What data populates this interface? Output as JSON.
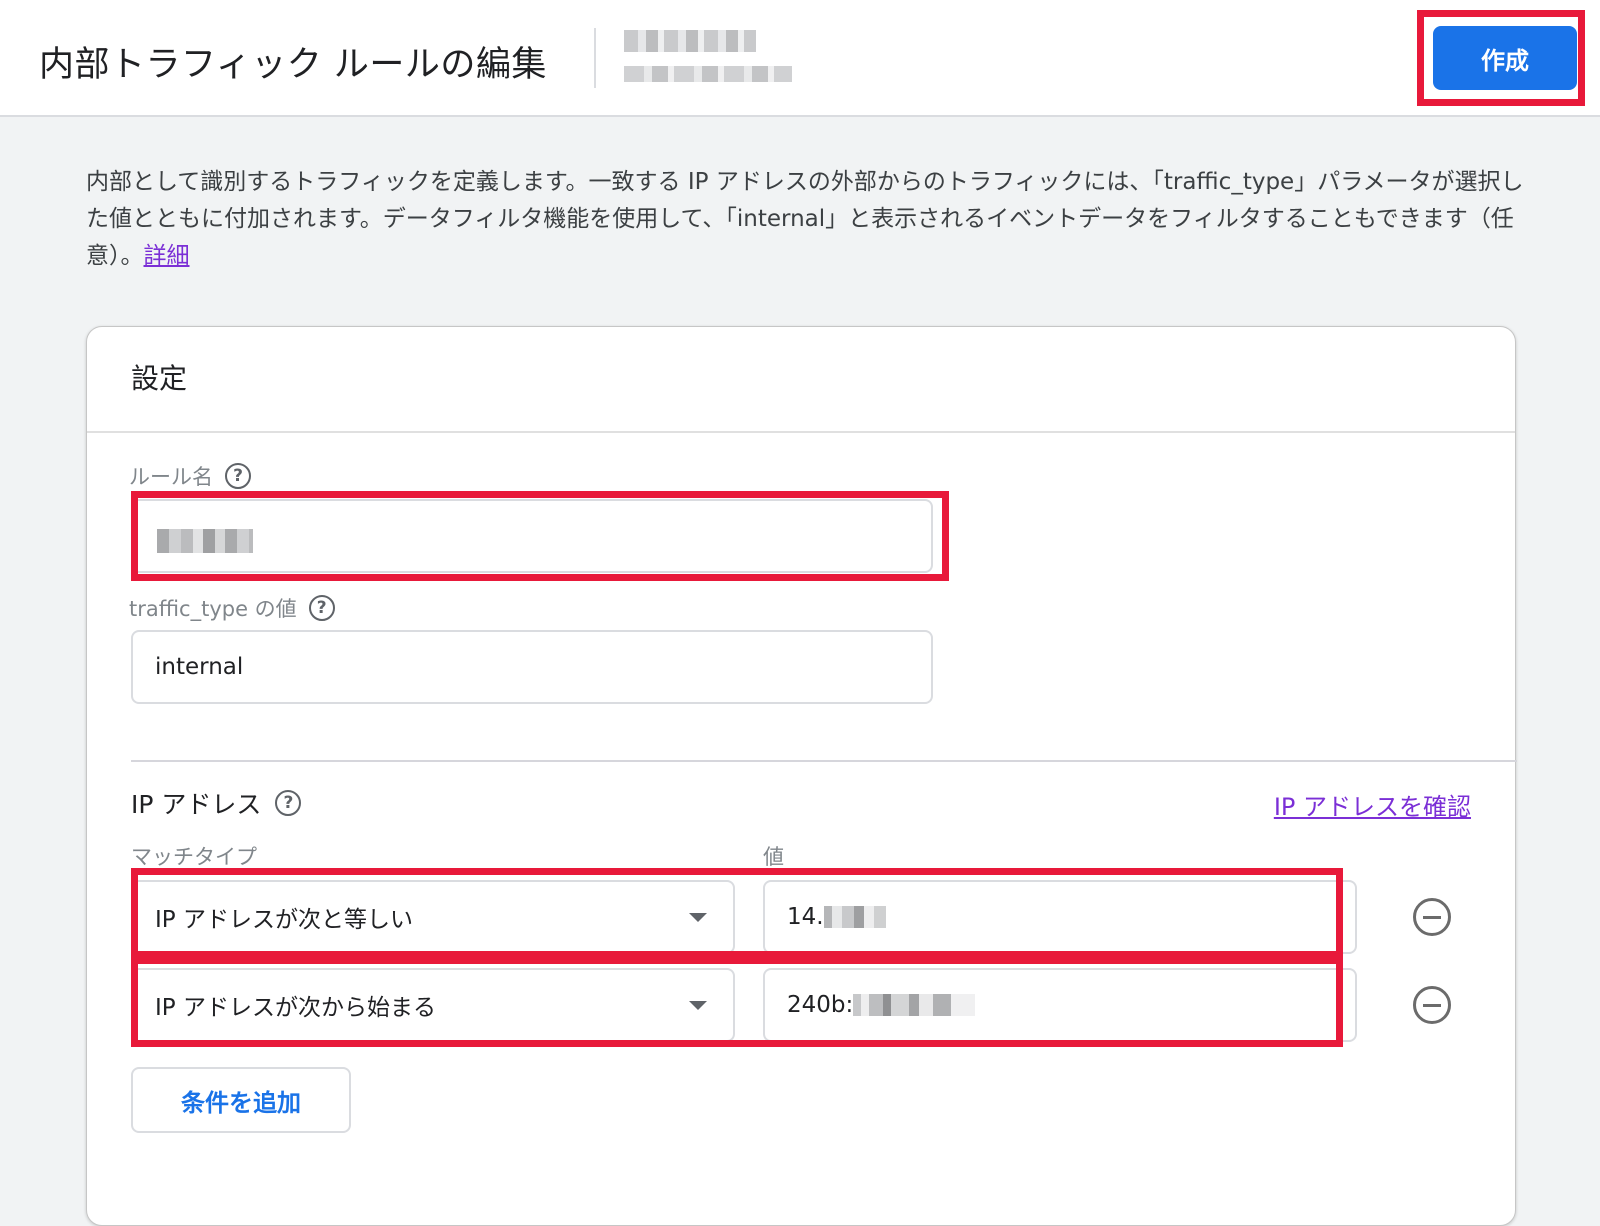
{
  "header": {
    "title": "内部トラフィック ルールの編集",
    "create_label": "作成"
  },
  "description": {
    "text": "内部として識別するトラフィックを定義します。一致する IP アドレスの外部からのトラフィックには、「traffic_type」パラメータが選択した値とともに付加されます。データフィルタ機能を使用して、「internal」と表示されるイベントデータをフィルタすることもできます（任意）。",
    "link_label": "詳細"
  },
  "card": {
    "title": "設定",
    "rule_name": {
      "label": "ルール名",
      "value": ""
    },
    "traffic_type": {
      "label": "traffic_type の値",
      "value": "internal"
    },
    "ip_section": {
      "title": "IP アドレス",
      "check_link_label": "IP アドレスを確認",
      "match_type_label": "マッチタイプ",
      "value_label": "値",
      "conditions": [
        {
          "match_type": "IP アドレスが次と等しい",
          "value_prefix": "14."
        },
        {
          "match_type": "IP アドレスが次から始まる",
          "value_prefix": "240b:"
        }
      ],
      "add_condition_label": "条件を追加"
    }
  },
  "icons": {
    "help": "?"
  },
  "colors": {
    "primary": "#1a73e8",
    "highlight": "#e8193a",
    "link": "#7b2fd6"
  }
}
